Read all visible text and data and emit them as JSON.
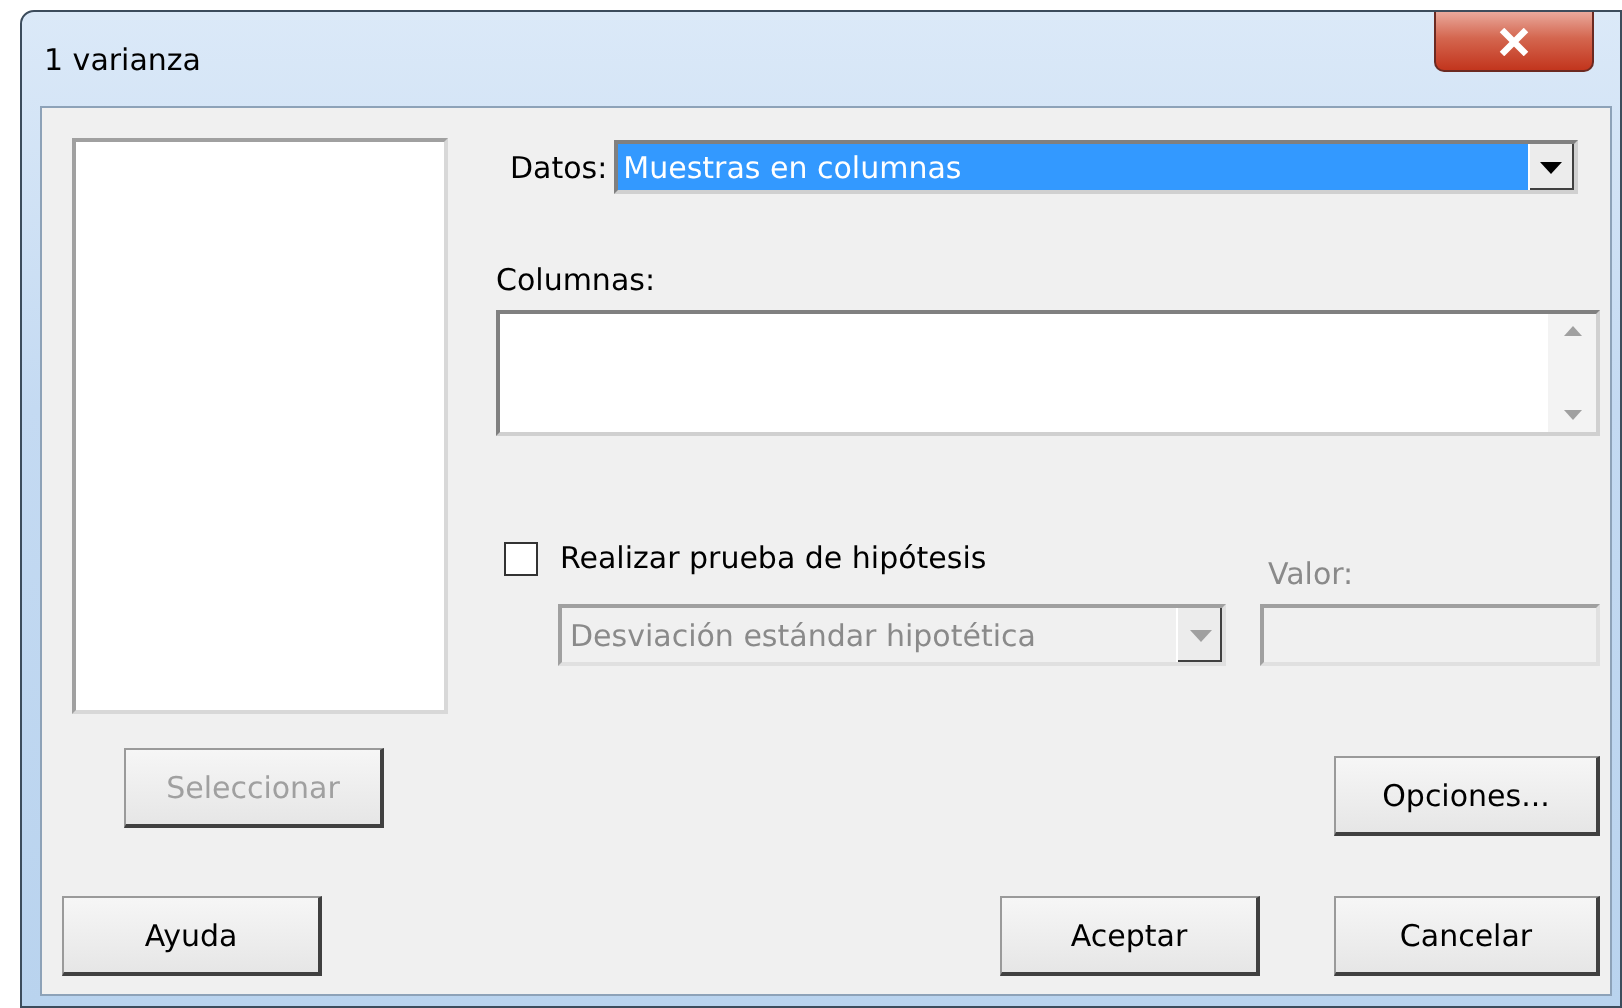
{
  "window": {
    "title": "1 varianza"
  },
  "data_field": {
    "label": "Datos:",
    "value": "Muestras en columnas",
    "selected": true
  },
  "columns_field": {
    "label": "Columnas:"
  },
  "hypothesis_test": {
    "label": "Realizar prueba de hipótesis",
    "checked": false
  },
  "parameter_select": {
    "value": "Desviación estándar hipotética",
    "disabled": true
  },
  "value_field": {
    "label": "Valor:",
    "disabled": true
  },
  "select_button": {
    "label": "Seleccionar",
    "disabled": true
  },
  "options_button": {
    "label": "Opciones...",
    "disabled": false
  },
  "footer_buttons": [
    {
      "label": "Ayuda",
      "disabled": false
    },
    {
      "label": "Aceptar",
      "disabled": false
    },
    {
      "label": "Cancelar",
      "disabled": false
    }
  ]
}
